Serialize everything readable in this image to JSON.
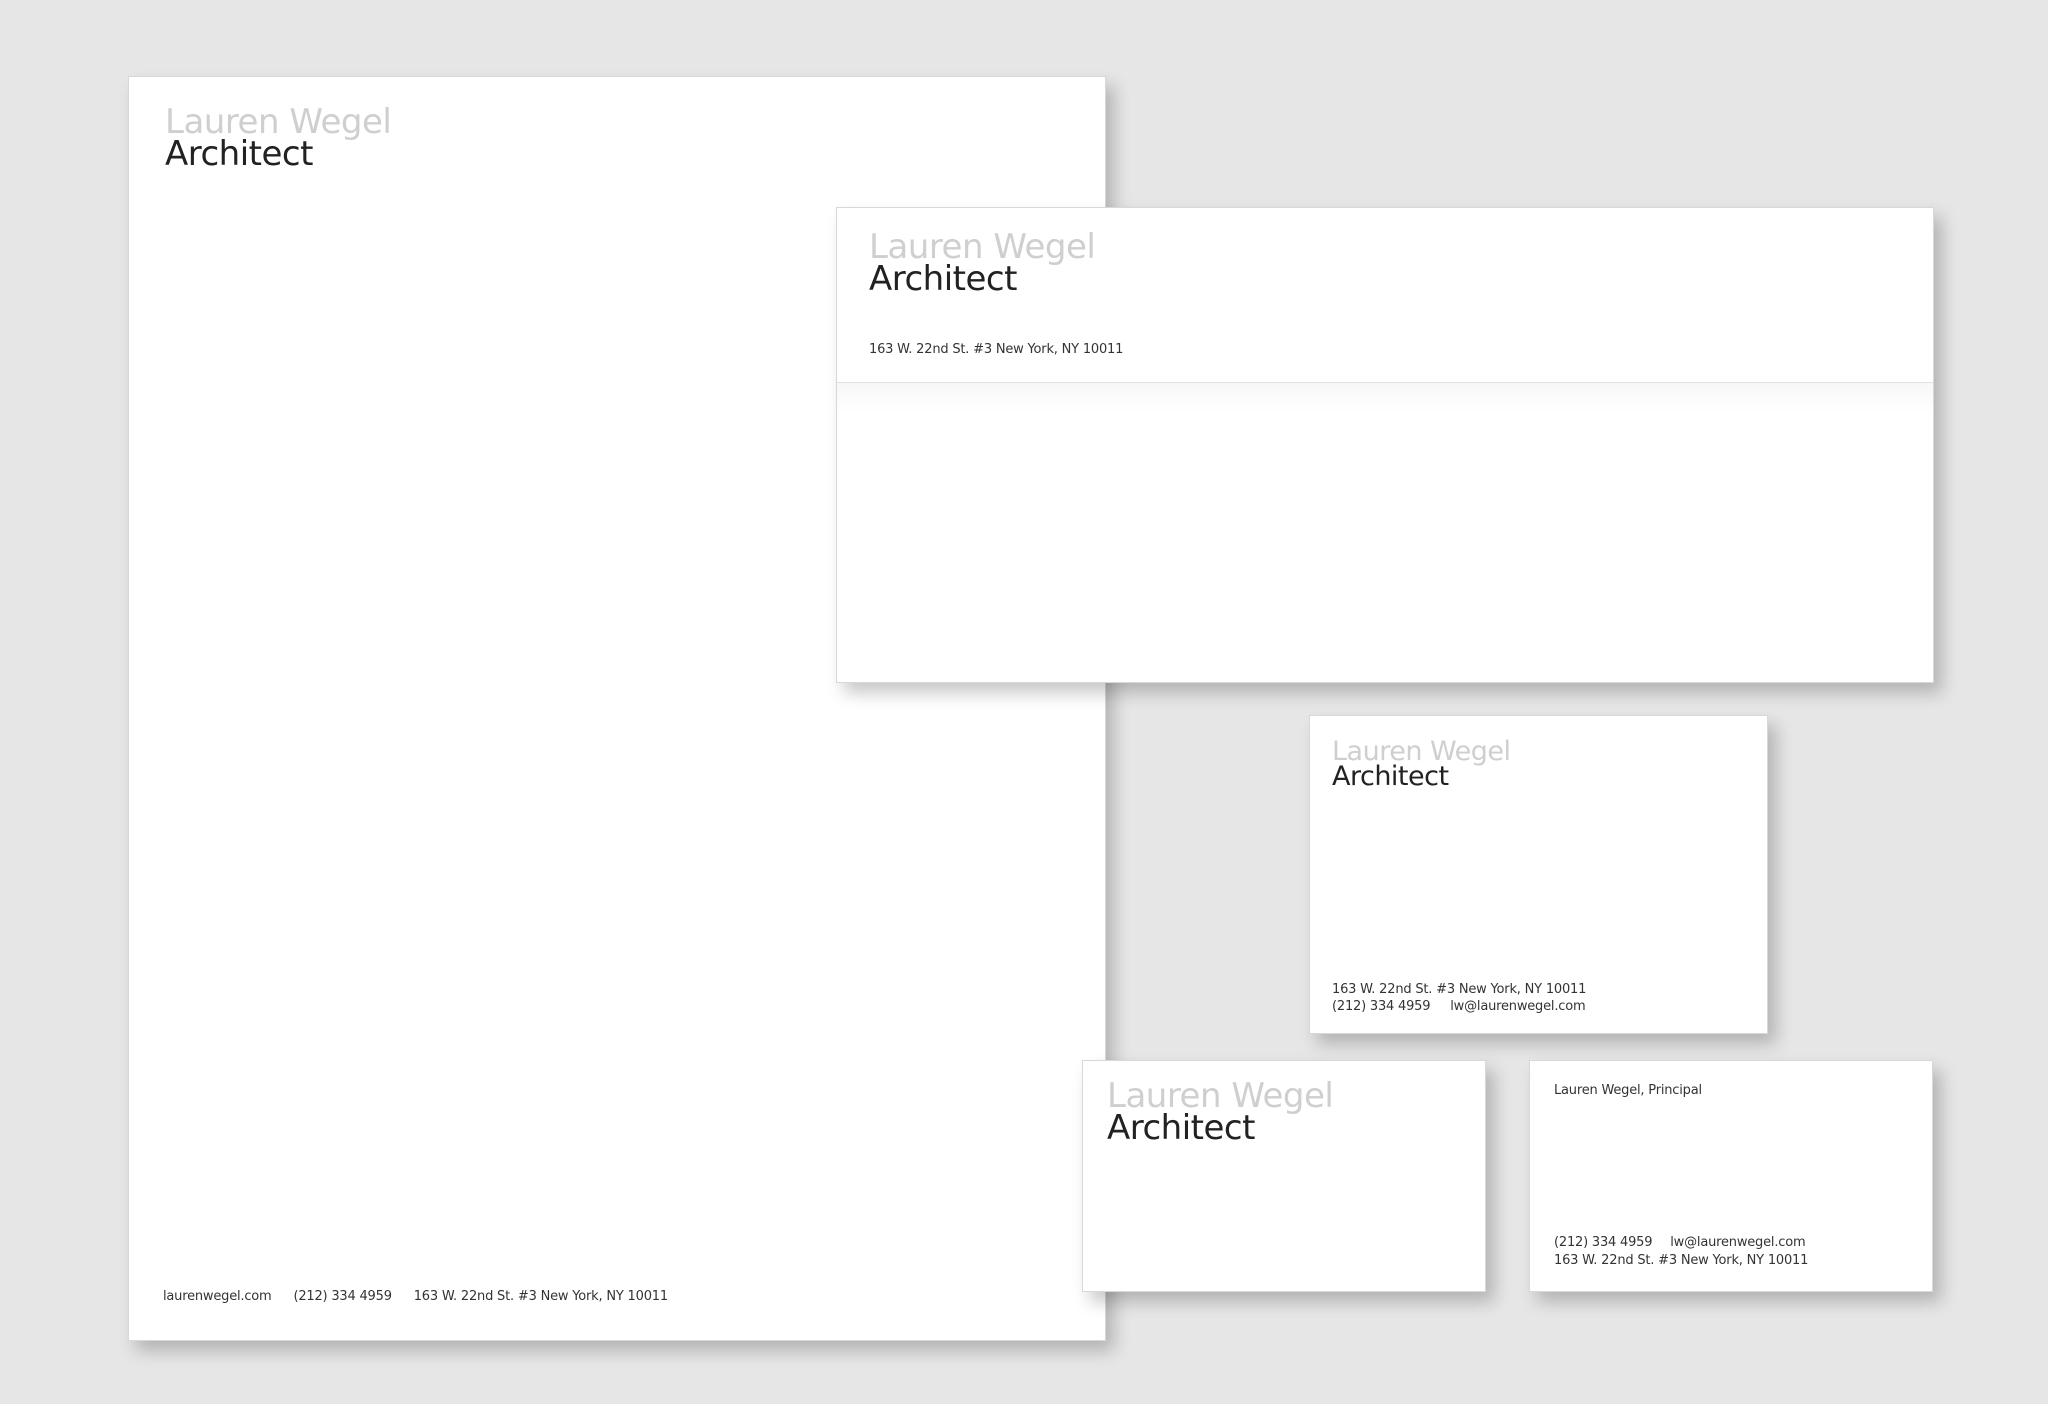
{
  "brand": {
    "name": "Lauren Wegel",
    "title": "Architect"
  },
  "letterhead": {
    "website": "laurenwegel.com",
    "phone": "(212) 334 4959",
    "address": "163 W. 22nd St. #3 New York, NY 10011"
  },
  "envelope": {
    "address": "163 W. 22nd St. #3 New York, NY 10011"
  },
  "notecard": {
    "address": "163 W. 22nd St. #3 New York, NY 10011",
    "phone": "(212) 334 4959",
    "email": "lw@laurenwegel.com"
  },
  "business_card_back": {
    "person": "Lauren Wegel, Principal",
    "phone": "(212) 334 4959",
    "email": "lw@laurenwegel.com",
    "address": "163 W. 22nd St. #3 New York, NY 10011"
  },
  "colors": {
    "background": "#e6e6e6",
    "paper": "#ffffff",
    "name_gray": "#cfcfcf",
    "title_black": "#222222"
  }
}
